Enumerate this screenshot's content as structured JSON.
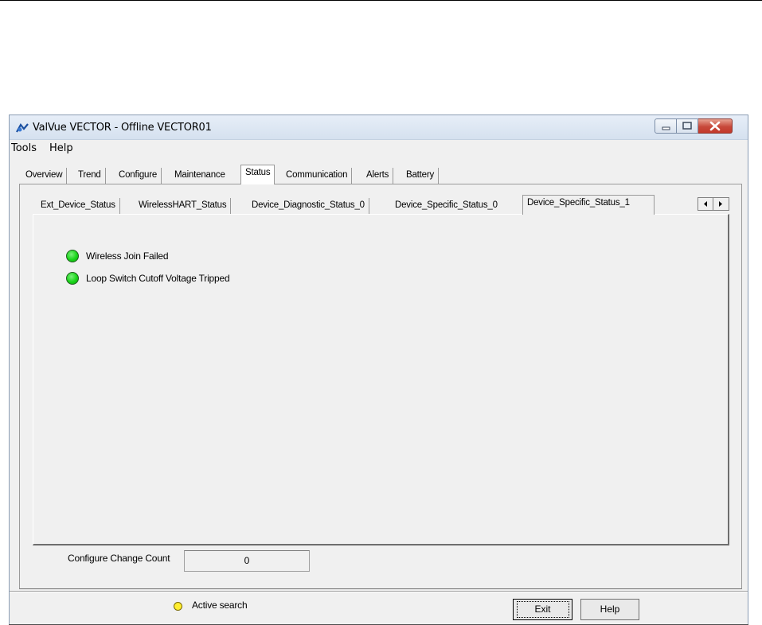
{
  "window": {
    "title": "ValVue VECTOR - Offline  VECTOR01",
    "controls": [
      "minimize",
      "maximize",
      "close"
    ]
  },
  "menu": {
    "items": [
      "Tools",
      "Help"
    ]
  },
  "outer_tabs": {
    "items": [
      "Overview",
      "Trend",
      "Configure",
      "Maintenance",
      "Status",
      "Communication",
      "Alerts",
      "Battery"
    ],
    "active": "Status"
  },
  "inner_tabs": {
    "items": [
      "Ext_Device_Status",
      "WirelessHART_Status",
      "Device_Diagnostic_Status_0",
      "Device_Specific_Status_0",
      "Device_Specific_Status_1"
    ],
    "active": "Device_Specific_Status_1"
  },
  "status_items": [
    {
      "label": "Wireless Join Failed",
      "state_color": "#18d418"
    },
    {
      "label": "Loop Switch Cutoff Voltage Tripped",
      "state_color": "#18d418"
    }
  ],
  "configure_change_count": {
    "label": "Configure Change Count",
    "value": "0"
  },
  "statusbar": {
    "search_label": "Active search",
    "search_color": "#ffee30"
  },
  "buttons": {
    "exit": "Exit",
    "help": "Help"
  },
  "icons": {
    "app": "valve-logo-icon",
    "scroll_left": "arrow-left-icon",
    "scroll_right": "arrow-right-icon"
  }
}
